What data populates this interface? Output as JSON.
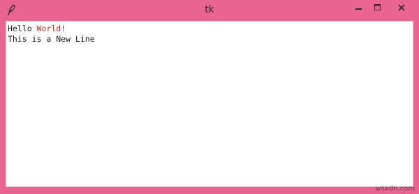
{
  "window": {
    "title": "tk",
    "app_icon": "feather-icon",
    "controls": {
      "minimize_icon": "minimize-icon",
      "maximize_icon": "maximize-icon",
      "close_icon": "close-icon"
    },
    "frame_color": "#e8658f"
  },
  "text_widget": {
    "line1_plain": "Hello ",
    "line1_colored": "World!",
    "line2": "This is a New Line",
    "colored_text_color": "#b5372e"
  },
  "watermark": "wsxdn.com"
}
